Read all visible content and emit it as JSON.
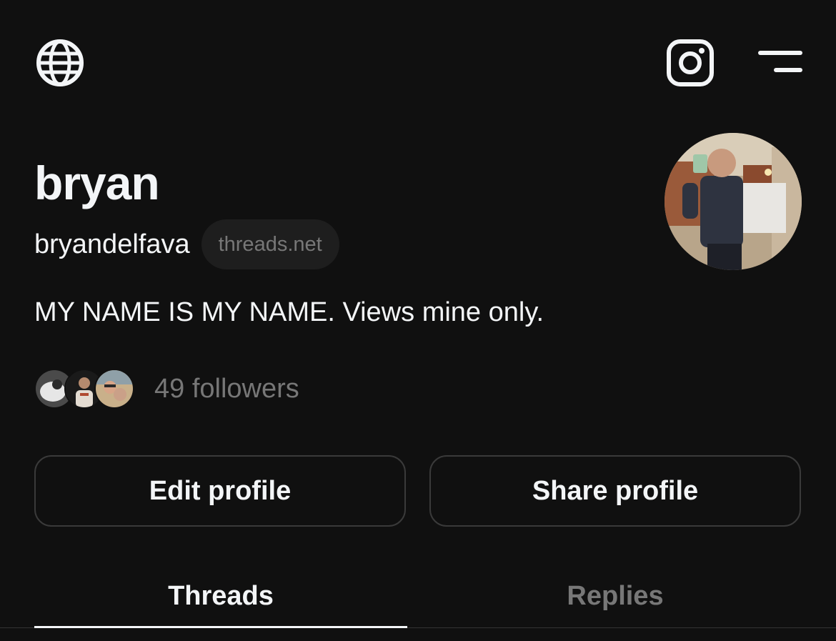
{
  "header": {
    "left_icon": "globe-icon",
    "right_icons": [
      "instagram-icon",
      "menu-icon"
    ]
  },
  "profile": {
    "display_name": "bryan",
    "username": "bryandelfava",
    "domain_badge": "threads.net",
    "bio": "MY NAME IS MY NAME. Views mine only.",
    "followers_label": "49 followers"
  },
  "actions": {
    "edit_label": "Edit profile",
    "share_label": "Share profile"
  },
  "tabs": [
    {
      "label": "Threads",
      "active": true
    },
    {
      "label": "Replies",
      "active": false
    }
  ],
  "colors": {
    "background": "#101010",
    "text_primary": "#f3f5f7",
    "text_secondary": "#777777",
    "border": "#3a3a3a"
  }
}
